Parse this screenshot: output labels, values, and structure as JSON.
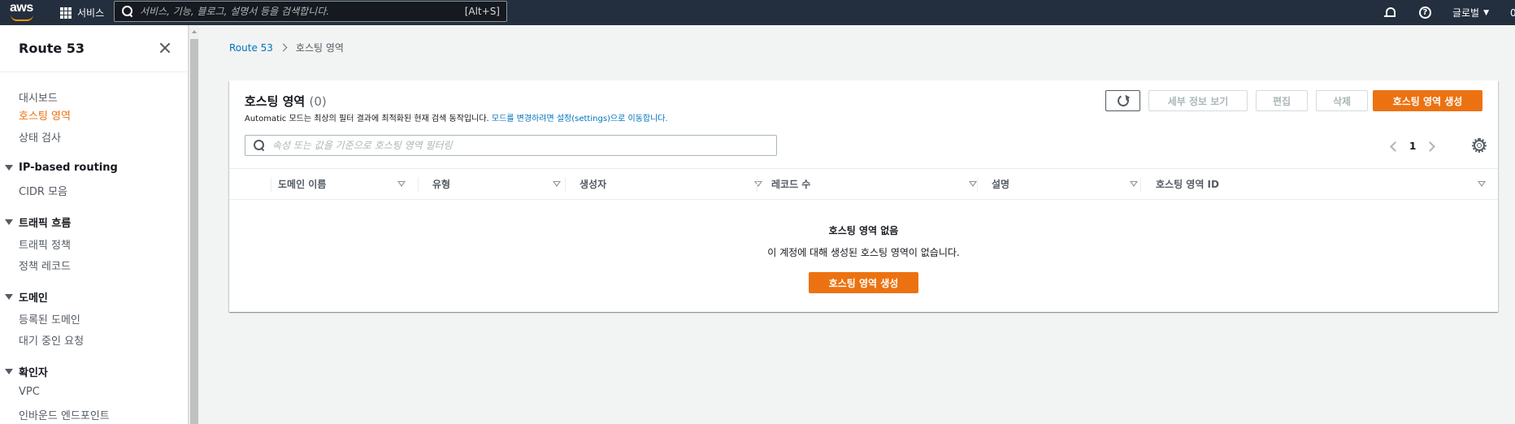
{
  "topnav": {
    "logo_text": "aws",
    "services_label": "서비스",
    "search_placeholder": "서비스, 기능, 블로그, 설명서 등을 검색합니다.",
    "search_shortcut": "[Alt+S]",
    "region_label": "글로벌",
    "account_label": "0"
  },
  "sidebar": {
    "title": "Route 53",
    "items": [
      {
        "label": "대시보드"
      },
      {
        "label": "호스팅 영역",
        "active": true
      },
      {
        "label": "상태 검사"
      }
    ],
    "sections": [
      {
        "label": "IP-based routing",
        "items": [
          "CIDR 모음"
        ]
      },
      {
        "label": "트래픽 흐름",
        "items": [
          "트래픽 정책",
          "정책 레코드"
        ]
      },
      {
        "label": "도메인",
        "items": [
          "등록된 도메인",
          "대기 중인 요청"
        ]
      },
      {
        "label": "확인자",
        "items": [
          "VPC",
          "인바운드 엔드포인트"
        ]
      }
    ]
  },
  "breadcrumb": {
    "root": "Route 53",
    "current": "호스팅 영역"
  },
  "panel": {
    "title": "호스팅 영역",
    "count": "(0)",
    "desc_prefix": "Automatic 모드는 최상의 필터 결과에 최적화된 현재 검색 동작입니다.",
    "desc_link": "모드를 변경하려면 설정(settings)으로 이동합니다.",
    "buttons": {
      "detail": "세부 정보 보기",
      "edit": "편집",
      "delete": "삭제",
      "create": "호스팅 영역 생성"
    },
    "filter_placeholder": "속성 또는 값을 기준으로 호스팅 영역 필터링",
    "page": "1",
    "columns": [
      "도메인 이름",
      "유형",
      "생성자",
      "레코드 수",
      "설명",
      "호스팅 영역 ID"
    ],
    "empty_title": "호스팅 영역 없음",
    "empty_desc": "이 계정에 대해 생성된 호스팅 영역이 없습니다.",
    "empty_button": "호스팅 영역 생성"
  },
  "colors": {
    "nav_bg": "#232f3e",
    "accent": "#ec7211",
    "link": "#0073bb"
  }
}
